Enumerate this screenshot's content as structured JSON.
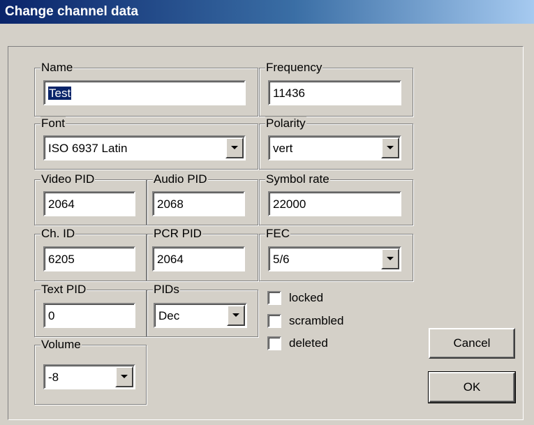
{
  "window": {
    "title": "Change channel data"
  },
  "fields": {
    "name": {
      "label": "Name",
      "value": "Test"
    },
    "frequency": {
      "label": "Frequency",
      "value": "11436"
    },
    "font": {
      "label": "Font",
      "value": "ISO 6937 Latin"
    },
    "polarity": {
      "label": "Polarity",
      "value": "vert"
    },
    "video_pid": {
      "label": "Video PID",
      "value": "2064"
    },
    "audio_pid": {
      "label": "Audio PID",
      "value": "2068"
    },
    "symbol_rate": {
      "label": "Symbol rate",
      "value": "22000"
    },
    "ch_id": {
      "label": "Ch. ID",
      "value": "6205"
    },
    "pcr_pid": {
      "label": "PCR PID",
      "value": "2064"
    },
    "fec": {
      "label": "FEC",
      "value": "5/6"
    },
    "text_pid": {
      "label": "Text PID",
      "value": "0"
    },
    "pids": {
      "label": "PIDs",
      "value": "Dec"
    },
    "volume": {
      "label": "Volume",
      "value": "-8"
    }
  },
  "checkboxes": {
    "locked": {
      "label": "locked",
      "checked": false
    },
    "scrambled": {
      "label": "scrambled",
      "checked": false
    },
    "deleted": {
      "label": "deleted",
      "checked": false
    }
  },
  "buttons": {
    "cancel": "Cancel",
    "ok": "OK"
  }
}
